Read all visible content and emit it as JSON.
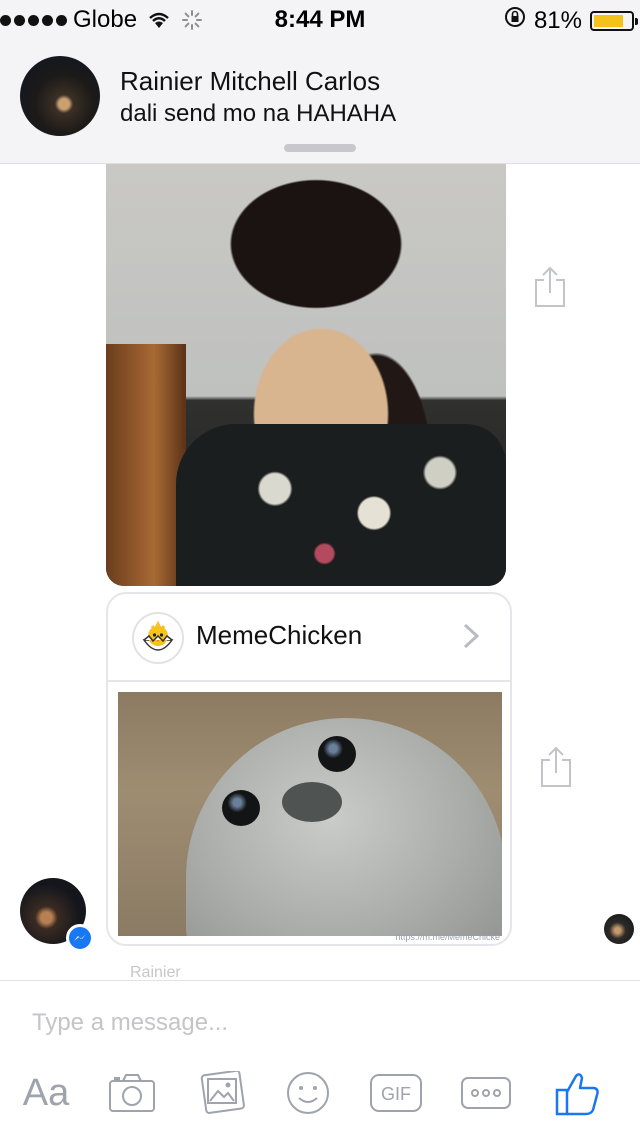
{
  "status_bar": {
    "carrier": "Globe",
    "time": "8:44 PM",
    "battery": "81%",
    "battery_level": 0.81,
    "icons": [
      "signal-dots-icon",
      "wifi-icon",
      "loading-icon",
      "rotation-lock-icon",
      "battery-icon"
    ]
  },
  "notification": {
    "sender_name": "Rainier Mitchell Carlos",
    "message": "dali send mo na HAHAHA"
  },
  "conversation": {
    "shared_card": {
      "source_name": "MemeChicken",
      "caption": "https://m.me/MemeChicke"
    },
    "typing_text": "Rainier"
  },
  "composer": {
    "placeholder": "Type a message...",
    "text_button_label": "Aa",
    "tools": [
      "text-format-icon",
      "camera-icon",
      "photo-gallery-icon",
      "sticker-icon",
      "gif-icon",
      "more-icon",
      "like-icon"
    ]
  },
  "colors": {
    "status_bar_bg": "#f4f4f6",
    "battery_fill": "#f3c21b",
    "accent": "#1877f2",
    "icon_gray": "#9ea3ad"
  }
}
